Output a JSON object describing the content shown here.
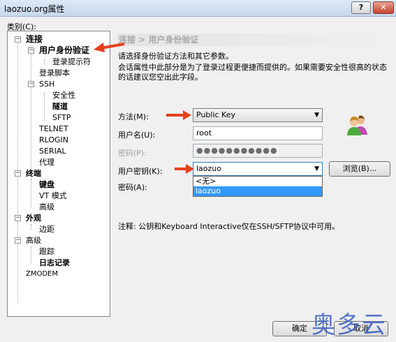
{
  "window": {
    "title": "laozuo.org属性",
    "help_label": "?",
    "close_label": "✕"
  },
  "category_label": "类别(C):",
  "tree": {
    "connection": "连接",
    "auth": "用户身份验证",
    "login_prompts": "登录提示符",
    "login_script": "登录脚本",
    "ssh": "SSH",
    "security": "安全性",
    "tunnel": "隧道",
    "sftp": "SFTP",
    "telnet": "TELNET",
    "rlogin": "RLOGIN",
    "serial": "SERIAL",
    "proxy": "代理",
    "terminal": "终端",
    "keyboard": "键盘",
    "vt_modes": "VT 模式",
    "advanced1": "高级",
    "appearance": "外观",
    "margins": "边距",
    "advanced2": "高级",
    "trace": "跟踪",
    "logging": "日志记录",
    "zmodem": "ZMODEM"
  },
  "panel": {
    "breadcrumb": "连接 > 用户身份验证",
    "desc1": "请选择身份验证方法和其它参数。",
    "desc2": "会话属性中此部分是为了登录过程更便捷而提供的。如果需要安全性很高的状态的话建议您空出此字段。",
    "method_label": "方法(M):",
    "method_value": "Public Key",
    "username_label": "用户名(U):",
    "username_value": "root",
    "password_label_disabled": "密码(P):",
    "password_dots": "●●●●●●●●●●●",
    "user_key_label": "用户密钥(K):",
    "user_key_value": "laozuo",
    "browse_label": "浏览(B)...",
    "passphrase_label": "密码(A):",
    "dropdown_options": [
      "<无>",
      "laozuo"
    ],
    "note": "注释: 公钥和Keyboard Interactive仅在SSH/SFTP协议中可用。"
  },
  "buttons": {
    "ok": "确定",
    "cancel": "取消"
  },
  "watermark": "奥多云",
  "colors": {
    "arrow": "#e8401c",
    "selection": "#3399ff",
    "watermark": "#3a5fc0"
  }
}
